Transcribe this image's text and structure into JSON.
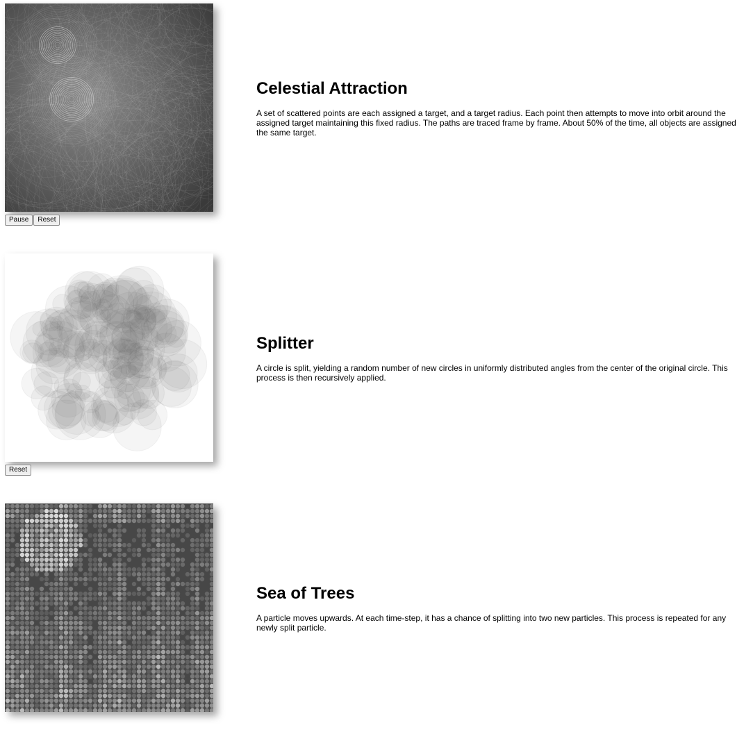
{
  "sections": [
    {
      "title": "Celestial Attraction",
      "description": "A set of scattered points are each assigned a target, and a target radius. Each point then attempts to move into orbit around the assigned target maintaining this fixed radius. The paths are traced frame by frame. About 50% of the time, all objects are assigned the same target.",
      "buttons": [
        "Pause",
        "Reset"
      ]
    },
    {
      "title": "Splitter",
      "description": "A circle is split, yielding a random number of new circles in uniformly distributed angles from the center of the original circle. This process is then recursively applied.",
      "buttons": [
        "Reset"
      ]
    },
    {
      "title": "Sea of Trees",
      "description": "A particle moves upwards. At each time-step, it has a chance of splitting into two new particles. This process is repeated for any newly split particle.",
      "buttons": []
    }
  ],
  "colors": {
    "celestial_bg": "#4a4a4a",
    "splitter_bg": "#ffffff",
    "trees_bg": "#474747"
  }
}
